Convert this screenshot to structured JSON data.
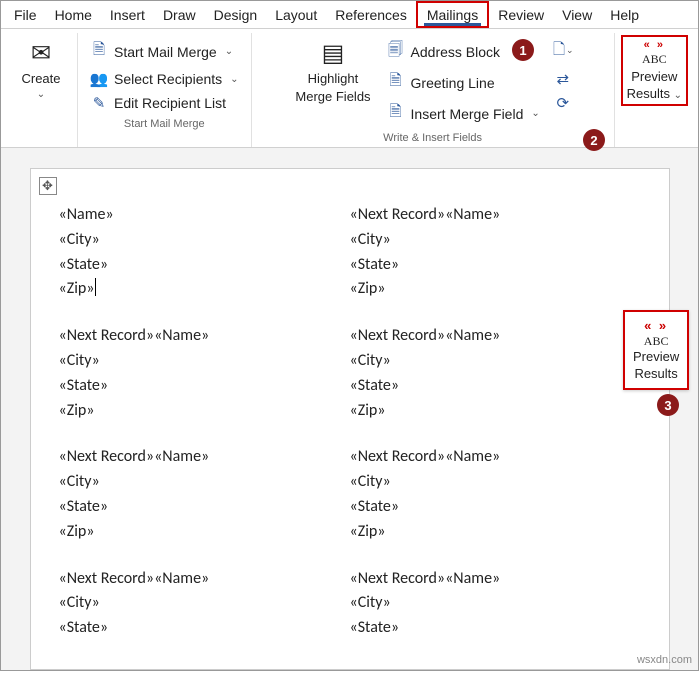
{
  "tabs": [
    "File",
    "Home",
    "Insert",
    "Draw",
    "Design",
    "Layout",
    "References",
    "Mailings",
    "Review",
    "View",
    "Help"
  ],
  "active_tab": "Mailings",
  "ribbon": {
    "create": {
      "label": "Create"
    },
    "start_group": {
      "label": "Start Mail Merge",
      "start": "Start Mail Merge",
      "select": "Select Recipients",
      "edit": "Edit Recipient List"
    },
    "highlight": {
      "line1": "Highlight",
      "line2": "Merge Fields"
    },
    "write_group": {
      "label": "Write & Insert Fields",
      "address": "Address Block",
      "greeting": "Greeting Line",
      "insert": "Insert Merge Field"
    },
    "preview": {
      "line1": "Preview",
      "line2": "Results",
      "abc": "ABC"
    }
  },
  "popup": {
    "abc": "ABC",
    "line1": "Preview",
    "line2": "Results"
  },
  "callouts": {
    "n1": "1",
    "n2": "2",
    "n3": "3"
  },
  "fields": {
    "name": "«Name»",
    "city": "«City»",
    "state": "«State»",
    "zip": "«Zip»",
    "next": "«Next Record»"
  },
  "doc_cells": [
    {
      "prefix": "",
      "cursor_after_zip": true
    },
    {
      "prefix": "next",
      "cursor_after_zip": false
    },
    {
      "prefix": "next",
      "cursor_after_zip": false
    },
    {
      "prefix": "next",
      "cursor_after_zip": false
    },
    {
      "prefix": "next",
      "cursor_after_zip": false
    },
    {
      "prefix": "next",
      "cursor_after_zip": false
    },
    {
      "prefix": "next",
      "cursor_after_zip": false,
      "rows": 3
    },
    {
      "prefix": "next",
      "cursor_after_zip": false,
      "rows": 3
    }
  ],
  "watermark": "wsxdn.com"
}
